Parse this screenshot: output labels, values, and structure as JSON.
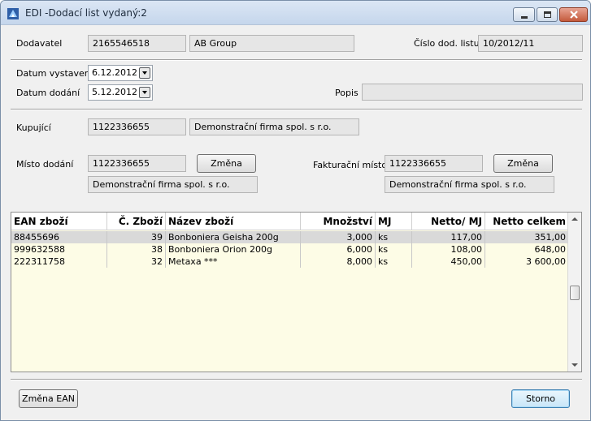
{
  "window": {
    "title": "EDI -Dodací list vydaný:2"
  },
  "header": {
    "supplier_label": "Dodavatel",
    "supplier_code": "2165546518",
    "supplier_name": "AB Group",
    "delivery_note_label": "Číslo dod. listu",
    "delivery_note_number": "10/2012/11"
  },
  "dates": {
    "issue_label": "Datum vystavení",
    "issue_value": "6.12.2012",
    "delivery_label": "Datum dodání",
    "delivery_value": "5.12.2012",
    "description_label": "Popis",
    "description_value": ""
  },
  "buyer": {
    "label": "Kupující",
    "code": "1122336655",
    "name": "Demonstrační firma spol. s r.o."
  },
  "delivery_place": {
    "label": "Místo dodání",
    "code": "1122336655",
    "change_label": "Změna",
    "name": "Demonstrační firma spol. s r.o."
  },
  "invoice_place": {
    "label": "Fakturační místo",
    "code": "1122336655",
    "change_label": "Změna",
    "name": "Demonstrační firma spol. s r.o."
  },
  "table": {
    "columns": [
      "EAN zboží",
      "Č. Zboží",
      "Název zboží",
      "Množství",
      "MJ",
      "Netto/ MJ",
      "Netto celkem"
    ],
    "rows": [
      [
        "88455696",
        "39",
        "Bonboniera Geisha 200g",
        "3,000",
        "ks",
        "117,00",
        "351,00"
      ],
      [
        "999632588",
        "38",
        "Bonboniera Orion 200g",
        "6,000",
        "ks",
        "108,00",
        "648,00"
      ],
      [
        "222311758",
        "32",
        "Metaxa ***",
        "8,000",
        "ks",
        "450,00",
        "3 600,00"
      ]
    ]
  },
  "footer": {
    "change_ean_label": "Změna EAN",
    "cancel_label": "Storno"
  }
}
